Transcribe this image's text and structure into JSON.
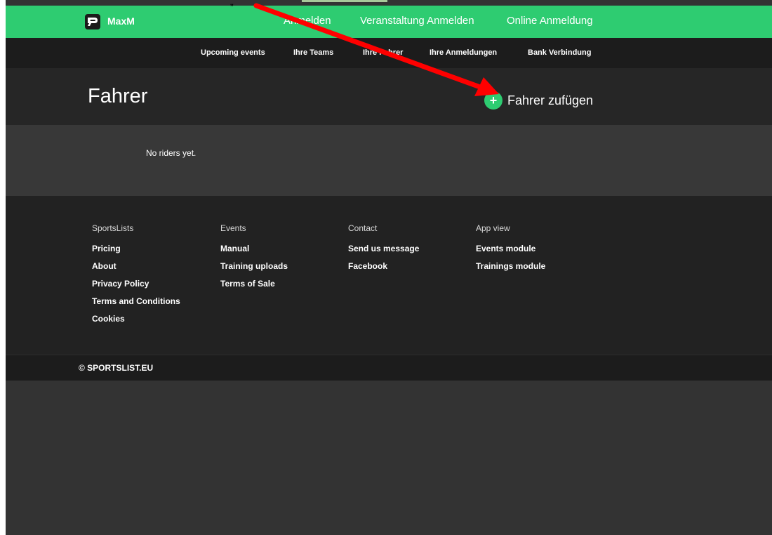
{
  "header": {
    "user_name": "MaxM",
    "nav": [
      {
        "label": "Anmelden"
      },
      {
        "label": "Veranstaltung Anmelden"
      },
      {
        "label": "Online Anmeldung"
      }
    ]
  },
  "subnav": [
    {
      "label": "Upcoming events"
    },
    {
      "label": "Ihre Teams"
    },
    {
      "label": "Ihre Fahrer"
    },
    {
      "label": "Ihre Anmeldungen"
    },
    {
      "label": "Bank Verbindung"
    }
  ],
  "page": {
    "title": "Fahrer",
    "add_button": {
      "icon": "plus-icon",
      "label": "Fahrer zufügen"
    },
    "empty_message": "No riders yet."
  },
  "footer": {
    "columns": [
      {
        "heading": "SportsLists",
        "links": [
          "Pricing",
          "About",
          "Privacy Policy",
          "Terms and Conditions",
          "Cookies"
        ]
      },
      {
        "heading": "Events",
        "links": [
          "Manual",
          "Training uploads",
          "Terms of Sale"
        ]
      },
      {
        "heading": "Contact",
        "links": [
          "Send us message",
          "Facebook"
        ]
      },
      {
        "heading": "App view",
        "links": [
          "Events module",
          "Trainings module"
        ]
      }
    ],
    "copyright": "© SPORTSLIST.EU"
  },
  "annotation": {
    "quote_mark": "„",
    "arrow_color": "#ff0000"
  },
  "colors": {
    "accent": "#2ecc71",
    "background": "#333333"
  }
}
